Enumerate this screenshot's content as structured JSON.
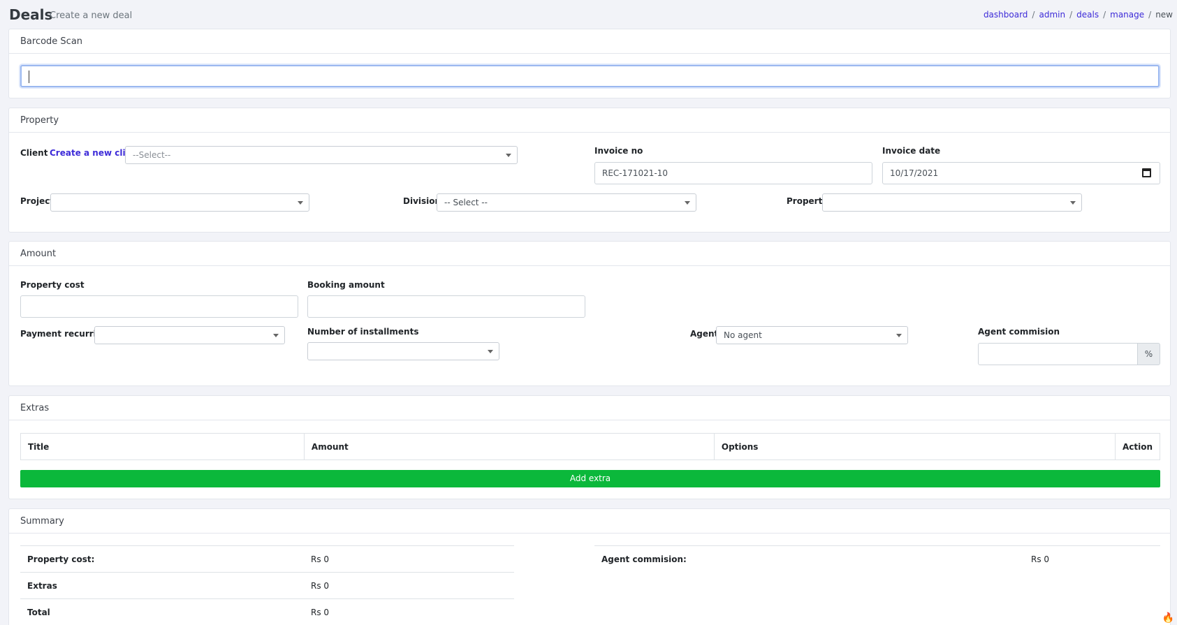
{
  "header": {
    "title": "Deals",
    "subtitle": "Create a new deal",
    "breadcrumb": [
      "dashboard",
      "admin",
      "deals",
      "manage"
    ],
    "breadcrumb_current": "new"
  },
  "barcode": {
    "title": "Barcode Scan",
    "value": ""
  },
  "property": {
    "title": "Property",
    "client_label": "Client",
    "create_client_link": "Create a new client",
    "client_value": "--Select--",
    "invoice_no_label": "Invoice no",
    "invoice_no_value": "REC-171021-10",
    "invoice_date_label": "Invoice date",
    "invoice_date_value": "10/17/2021",
    "project_label": "Project",
    "project_value": "",
    "division_label": "Division",
    "division_value": "-- Select --",
    "property_label": "Property",
    "property_value": ""
  },
  "amount": {
    "title": "Amount",
    "property_cost_label": "Property cost",
    "booking_amount_label": "Booking amount",
    "payment_recurring_label": "Payment recurring",
    "installments_label": "Number of installments",
    "agent_label": "Agent",
    "agent_value": "No agent",
    "agent_commission_label": "Agent commision",
    "percent_addon": "%"
  },
  "extras": {
    "title": "Extras",
    "columns": [
      "Title",
      "Amount",
      "Options",
      "Action"
    ],
    "add_button": "Add extra"
  },
  "summary": {
    "title": "Summary",
    "rows": [
      {
        "label": "Property cost:",
        "value": "Rs 0"
      },
      {
        "label": "Extras",
        "value": "Rs 0"
      },
      {
        "label": "Total",
        "value": "Rs 0"
      }
    ],
    "agent_commission_label": "Agent commision:",
    "agent_commission_value": "Rs 0"
  },
  "colors": {
    "accent_link": "#3d2bd8",
    "add_button": "#0bb83b",
    "background": "#f2f3f8"
  }
}
